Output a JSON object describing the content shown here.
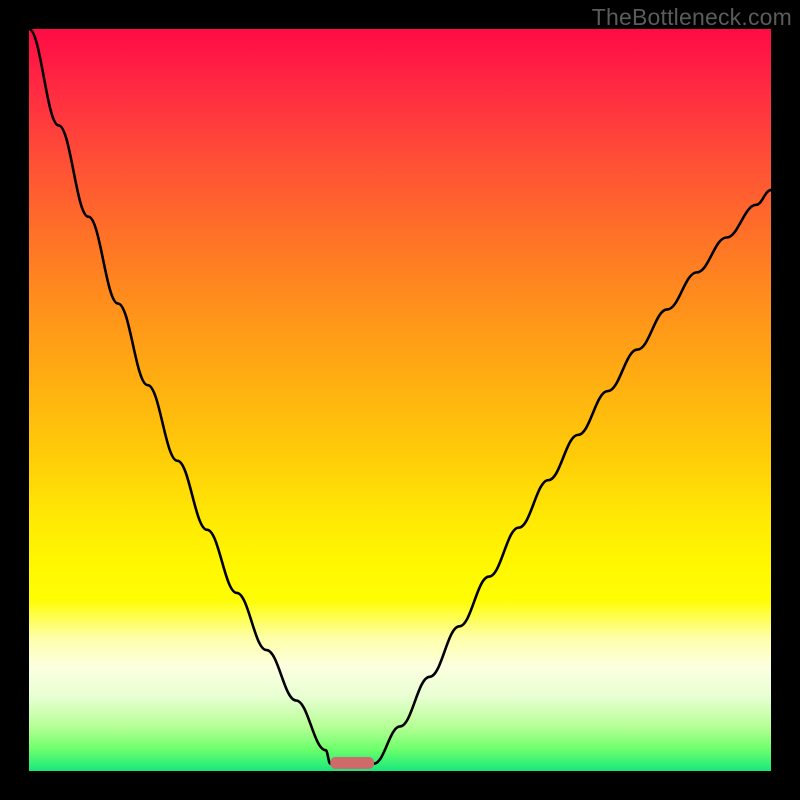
{
  "watermark": "TheBottleneck.com",
  "marker": {
    "x_fraction": 0.406,
    "width_fraction": 0.059,
    "color": "#cf6a6b"
  },
  "chart_data": {
    "type": "line",
    "title": "",
    "xlabel": "",
    "ylabel": "",
    "xlim": [
      0,
      1
    ],
    "ylim": [
      0,
      1
    ],
    "annotations": [],
    "series": [
      {
        "name": "left-branch",
        "x": [
          0.0,
          0.04,
          0.08,
          0.12,
          0.16,
          0.2,
          0.24,
          0.28,
          0.32,
          0.36,
          0.4,
          0.406
        ],
        "y": [
          1.0,
          0.87,
          0.747,
          0.63,
          0.52,
          0.418,
          0.325,
          0.24,
          0.163,
          0.095,
          0.028,
          0.01
        ]
      },
      {
        "name": "right-branch",
        "x": [
          0.465,
          0.5,
          0.54,
          0.58,
          0.62,
          0.66,
          0.7,
          0.74,
          0.78,
          0.82,
          0.86,
          0.9,
          0.94,
          0.98,
          1.0
        ],
        "y": [
          0.01,
          0.06,
          0.127,
          0.195,
          0.262,
          0.328,
          0.392,
          0.453,
          0.512,
          0.568,
          0.622,
          0.672,
          0.719,
          0.763,
          0.783
        ]
      }
    ],
    "background_gradient": {
      "top_color": "#ff0b45",
      "mid_color": "#ffe904",
      "bottom_color": "#17e87b"
    }
  }
}
